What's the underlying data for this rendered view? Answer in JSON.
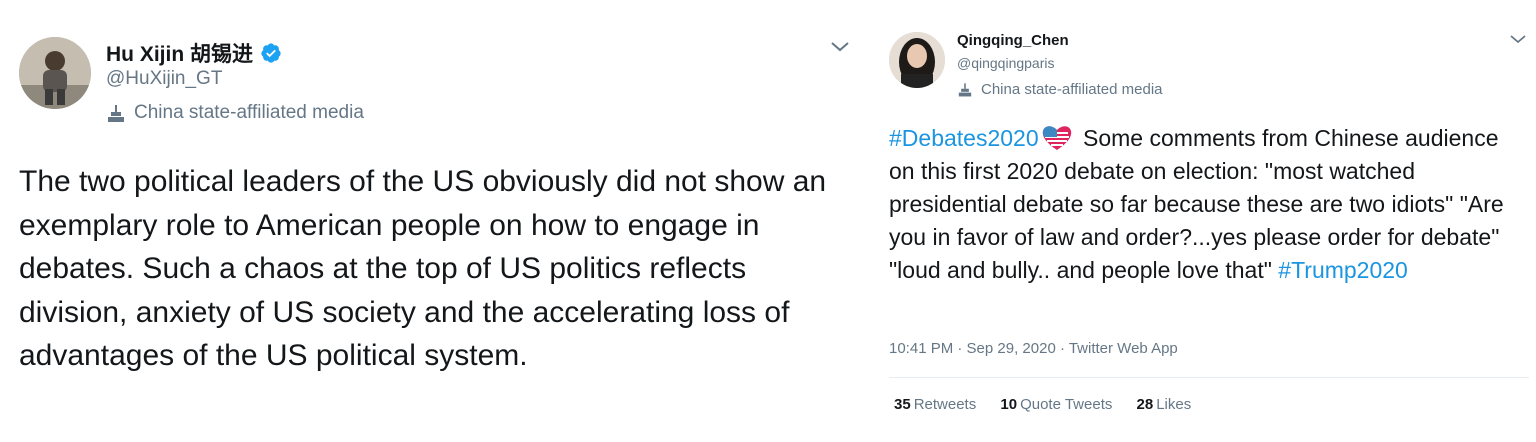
{
  "tweet1": {
    "name": "Hu Xijin 胡锡进",
    "handle": "@HuXijin_GT",
    "label": "China state-affiliated media",
    "text": "The two political leaders of the US obviously did not show an exemplary role to American people on how to engage in debates. Such a chaos at the top of US politics reflects division, anxiety of US society and the accelerating loss of advantages of the US political system.",
    "verified_icon": "verified-badge-icon",
    "menu_icon": "chevron-down-icon"
  },
  "tweet2": {
    "name": "Qingqing_Chen",
    "handle": "@qingqingparis",
    "label": "China state-affiliated media",
    "hashtag1": "#Debates2020",
    "body": " Some comments from Chinese audience on this first 2020 debate on election: \"most watched presidential debate so far because these are two idiots\" \"Are you in favor of law and order?...yes please order for debate\" \"loud and bully.. and people love that\" ",
    "hashtag2": "#Trump2020",
    "meta": "10:41 PM · Sep 29, 2020 · Twitter Web App",
    "retweets_count": "35",
    "retweets_label": "Retweets",
    "quotes_count": "10",
    "quotes_label": "Quote Tweets",
    "likes_count": "28",
    "likes_label": "Likes",
    "menu_icon": "chevron-down-icon"
  },
  "colors": {
    "link": "#1b95e0",
    "secondary_text": "#657786",
    "verified": "#1da1f2"
  }
}
